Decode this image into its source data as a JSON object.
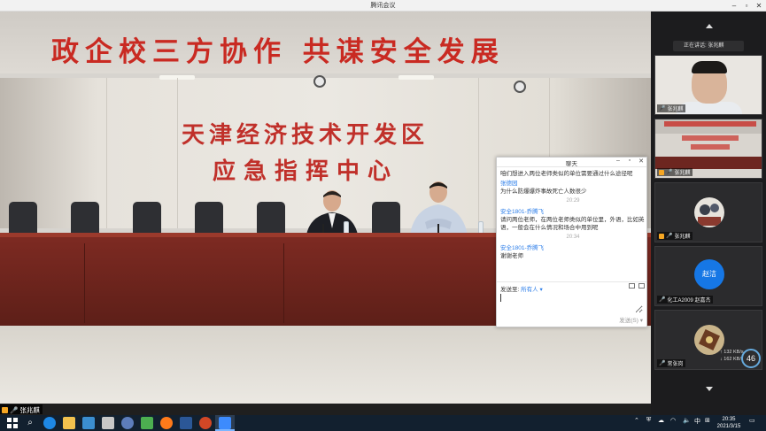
{
  "window": {
    "title": "腾讯会议"
  },
  "main_video": {
    "banner": "政企校三方协作  共谋安全发展",
    "wall_line_1": "天津经济技术开发区",
    "wall_line_2": "应急指挥中心"
  },
  "speaker_tag": {
    "name": "张兆麒"
  },
  "chat": {
    "title": "聊天",
    "messages": [
      {
        "name": "",
        "body": "咱们想进入两位老师类似的单位需要通过什么途径呢",
        "time": ""
      },
      {
        "name": "张德园",
        "body": "为什么防爆爆炸事故死亡人数很少",
        "time": "20:29"
      },
      {
        "name": "安全1801-乔腾飞",
        "body": "请问两位老师，在两位老师类似的单位里，外语，比如英语，一般会在什么情况和场合中用到呢",
        "time": "20:34"
      },
      {
        "name": "安全1801-乔腾飞",
        "body": "谢谢老师",
        "time": ""
      }
    ],
    "send_to_label": "发送至:",
    "send_to_value": "所有人",
    "send_button": "发送(S)"
  },
  "right_panel": {
    "speaking_label": "正在讲话: 张兆麒",
    "tiles": [
      {
        "label": "张兆麒"
      },
      {
        "label": "张兆麒"
      },
      {
        "label": "张兆麒"
      },
      {
        "label": "化工A2009 赵嘉杰",
        "avatar_text": "赵洁"
      },
      {
        "label": "常张岗"
      }
    ],
    "stats_up": "↑ 132",
    "stats_down": "↓ 162",
    "stats_unit": "KB/s",
    "cpu_badge": "46"
  },
  "taskbar": {
    "time": "20:35",
    "date": "2021/3/15",
    "ime": "中",
    "ime2": "⊞"
  }
}
